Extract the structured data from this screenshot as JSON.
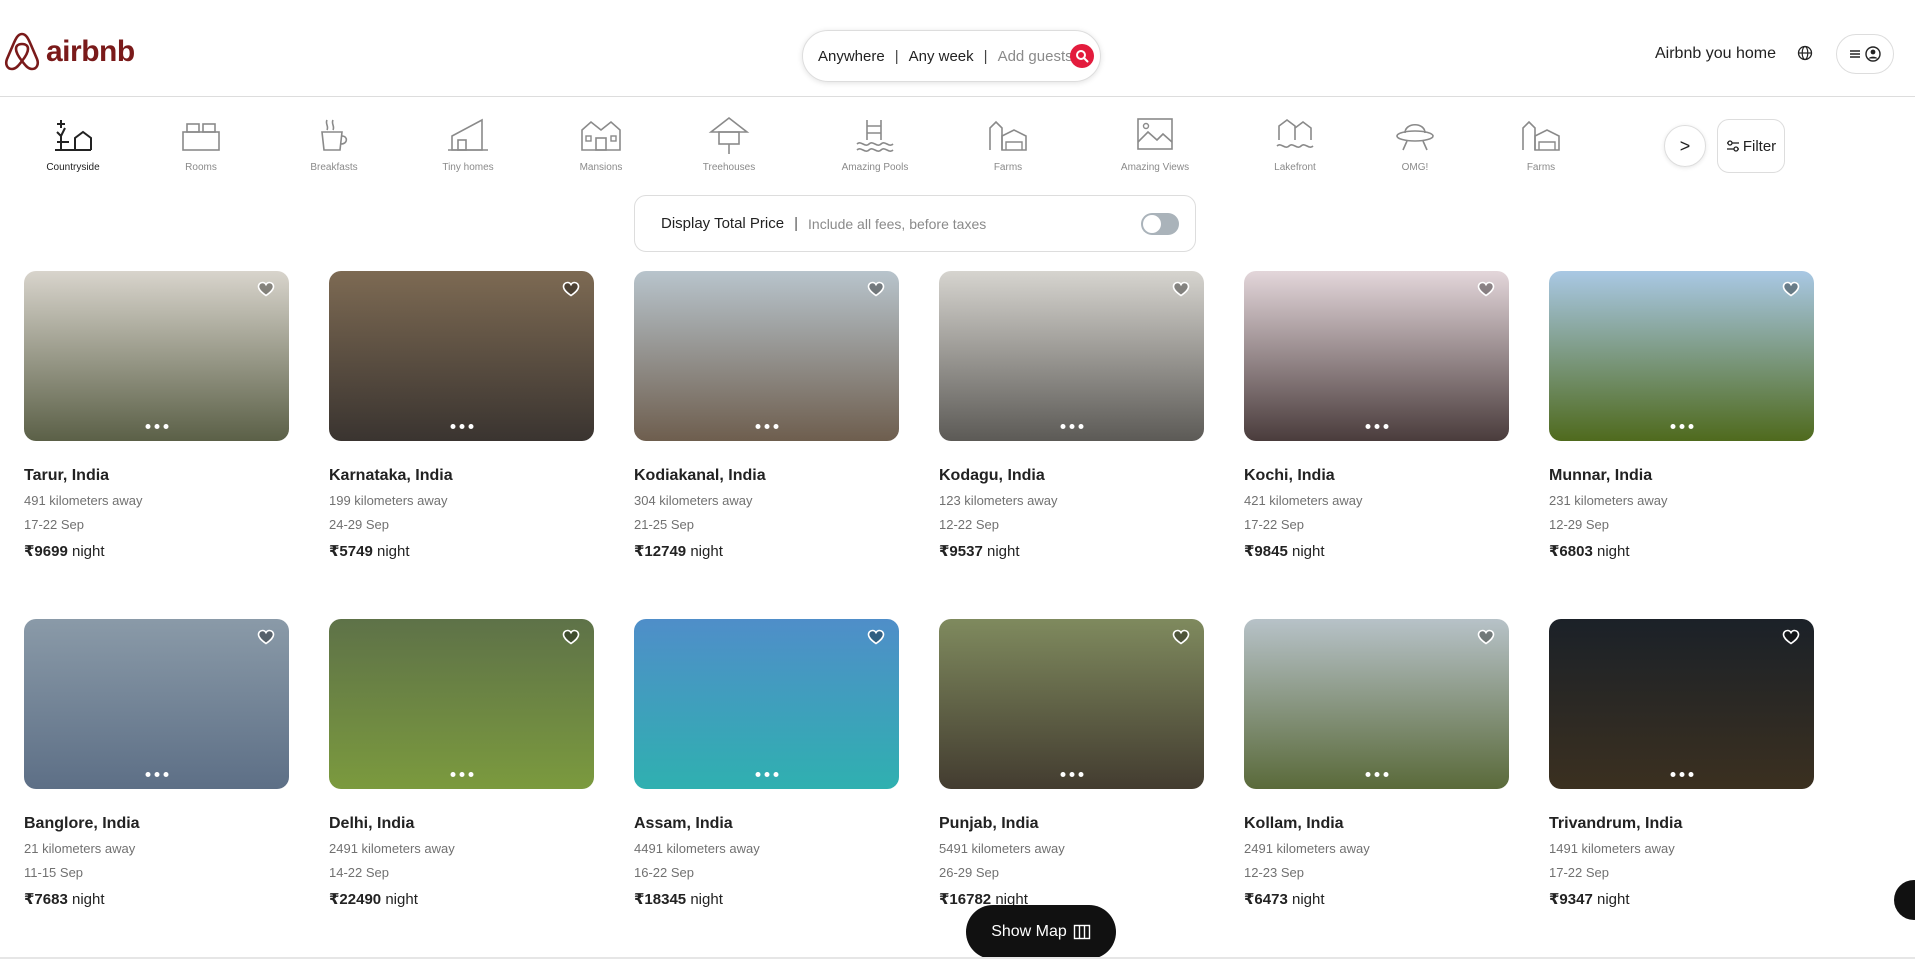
{
  "header": {
    "logo_text": "airbnb",
    "brand_color": "#7a1a1a",
    "search": {
      "where": "Anywhere",
      "when": "Any week",
      "guests_placeholder": "Add guests",
      "separator": "|"
    },
    "host_link": "Airbnb you home",
    "icons": {
      "search": "search-icon",
      "globe": "globe-icon",
      "menu": "menu-icon",
      "user": "user-icon"
    }
  },
  "categories": [
    {
      "label": "Countryside",
      "icon": "countryside-icon",
      "active": true
    },
    {
      "label": "Rooms",
      "icon": "rooms-icon",
      "active": false
    },
    {
      "label": "Breakfasts",
      "icon": "breakfasts-icon",
      "active": false
    },
    {
      "label": "Tiny homes",
      "icon": "tiny-homes-icon",
      "active": false
    },
    {
      "label": "Mansions",
      "icon": "mansions-icon",
      "active": false
    },
    {
      "label": "Treehouses",
      "icon": "treehouses-icon",
      "active": false
    },
    {
      "label": "Amazing Pools",
      "icon": "amazing-pools-icon",
      "active": false
    },
    {
      "label": "Farms",
      "icon": "farms-icon",
      "active": false
    },
    {
      "label": "Amazing Views",
      "icon": "amazing-views-icon",
      "active": false
    },
    {
      "label": "Lakefront",
      "icon": "lakefront-icon",
      "active": false
    },
    {
      "label": "OMG!",
      "icon": "omg-icon",
      "active": false
    },
    {
      "label": "Farms",
      "icon": "farms-icon",
      "active": false
    }
  ],
  "next_label": ">",
  "filter_label": "Filter",
  "price_toggle": {
    "label": "Display Total Price",
    "separator": "|",
    "sub": "Include all fees, before taxes"
  },
  "listings": [
    {
      "location": "Tarur, India",
      "distance": "491 kilometers away",
      "dates": "17-22 Sep",
      "price": "₹9699",
      "unit": "night",
      "photo_top": "#d8d4cc",
      "photo_bottom": "#5b6047"
    },
    {
      "location": "Karnataka, India",
      "distance": "199 kilometers away",
      "dates": "24-29 Sep",
      "price": "₹5749",
      "unit": "night",
      "photo_top": "#7d6a53",
      "photo_bottom": "#3a3430"
    },
    {
      "location": "Kodiakanal, India",
      "distance": "304 kilometers away",
      "dates": "21-25 Sep",
      "price": "₹12749",
      "unit": "night",
      "photo_top": "#b8c4cc",
      "photo_bottom": "#6e5e4e"
    },
    {
      "location": "Kodagu, India",
      "distance": "123 kilometers away",
      "dates": "12-22 Sep",
      "price": "₹9537",
      "unit": "night",
      "photo_top": "#d6d4cf",
      "photo_bottom": "#5c5a56"
    },
    {
      "location": "Kochi, India",
      "distance": "421 kilometers away",
      "dates": "17-22 Sep",
      "price": "₹9845",
      "unit": "night",
      "photo_top": "#e3d6da",
      "photo_bottom": "#4a3c3c"
    },
    {
      "location": "Munnar, India",
      "distance": "231 kilometers away",
      "dates": "12-29 Sep",
      "price": "₹6803",
      "unit": "night",
      "photo_top": "#a9c8e4",
      "photo_bottom": "#4f6a1d"
    },
    {
      "location": "Banglore, India",
      "distance": "21 kilometers away",
      "dates": "11-15 Sep",
      "price": "₹7683",
      "unit": "night",
      "photo_top": "#8a9aa8",
      "photo_bottom": "#5d6f86"
    },
    {
      "location": "Delhi, India",
      "distance": "2491 kilometers away",
      "dates": "14-22 Sep",
      "price": "₹22490",
      "unit": "night",
      "photo_top": "#5e7248",
      "photo_bottom": "#7b9a3e"
    },
    {
      "location": "Assam, India",
      "distance": "4491 kilometers away",
      "dates": "16-22 Sep",
      "price": "₹18345",
      "unit": "night",
      "photo_top": "#4f8ec9",
      "photo_bottom": "#2fb0b0"
    },
    {
      "location": "Punjab, India",
      "distance": "5491 kilometers away",
      "dates": "26-29 Sep",
      "price": "₹16782",
      "unit": "night",
      "photo_top": "#7f8a5e",
      "photo_bottom": "#433c30"
    },
    {
      "location": "Kollam, India",
      "distance": "2491 kilometers away",
      "dates": "12-23 Sep",
      "price": "₹6473",
      "unit": "night",
      "photo_top": "#b7c2c8",
      "photo_bottom": "#5a6a3a"
    },
    {
      "location": "Trivandrum, India",
      "distance": "1491 kilometers away",
      "dates": "17-22 Sep",
      "price": "₹9347",
      "unit": "night",
      "photo_top": "#1b2128",
      "photo_bottom": "#3b3020"
    }
  ],
  "show_map_label": "Show Map"
}
